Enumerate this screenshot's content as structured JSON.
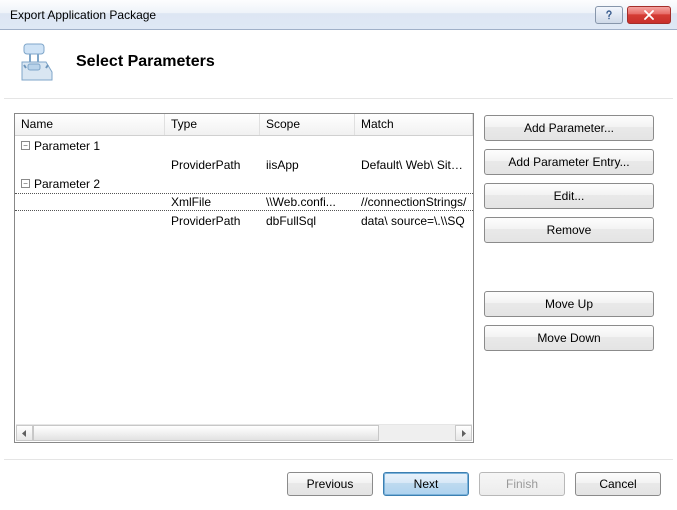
{
  "window": {
    "title": "Export Application Package"
  },
  "header": {
    "title": "Select Parameters"
  },
  "table": {
    "columns": {
      "name": "Name",
      "type": "Type",
      "scope": "Scope",
      "match": "Match"
    },
    "rows": [
      {
        "kind": "parent",
        "name": "Parameter 1"
      },
      {
        "kind": "child",
        "type": "ProviderPath",
        "scope": "iisApp",
        "match": "Default\\ Web\\ Site/M"
      },
      {
        "kind": "parent",
        "name": "Parameter 2"
      },
      {
        "kind": "child",
        "type": "XmlFile",
        "scope": "\\\\Web.confi...",
        "match": "//connectionStrings/",
        "selected": true
      },
      {
        "kind": "child",
        "type": "ProviderPath",
        "scope": "dbFullSql",
        "match": "data\\ source=\\.\\\\SQ"
      }
    ]
  },
  "side": {
    "add_param": "Add Parameter...",
    "add_entry": "Add Parameter Entry...",
    "edit": "Edit...",
    "remove": "Remove",
    "move_up": "Move Up",
    "move_down": "Move Down"
  },
  "footer": {
    "previous": "Previous",
    "next": "Next",
    "finish": "Finish",
    "cancel": "Cancel"
  }
}
